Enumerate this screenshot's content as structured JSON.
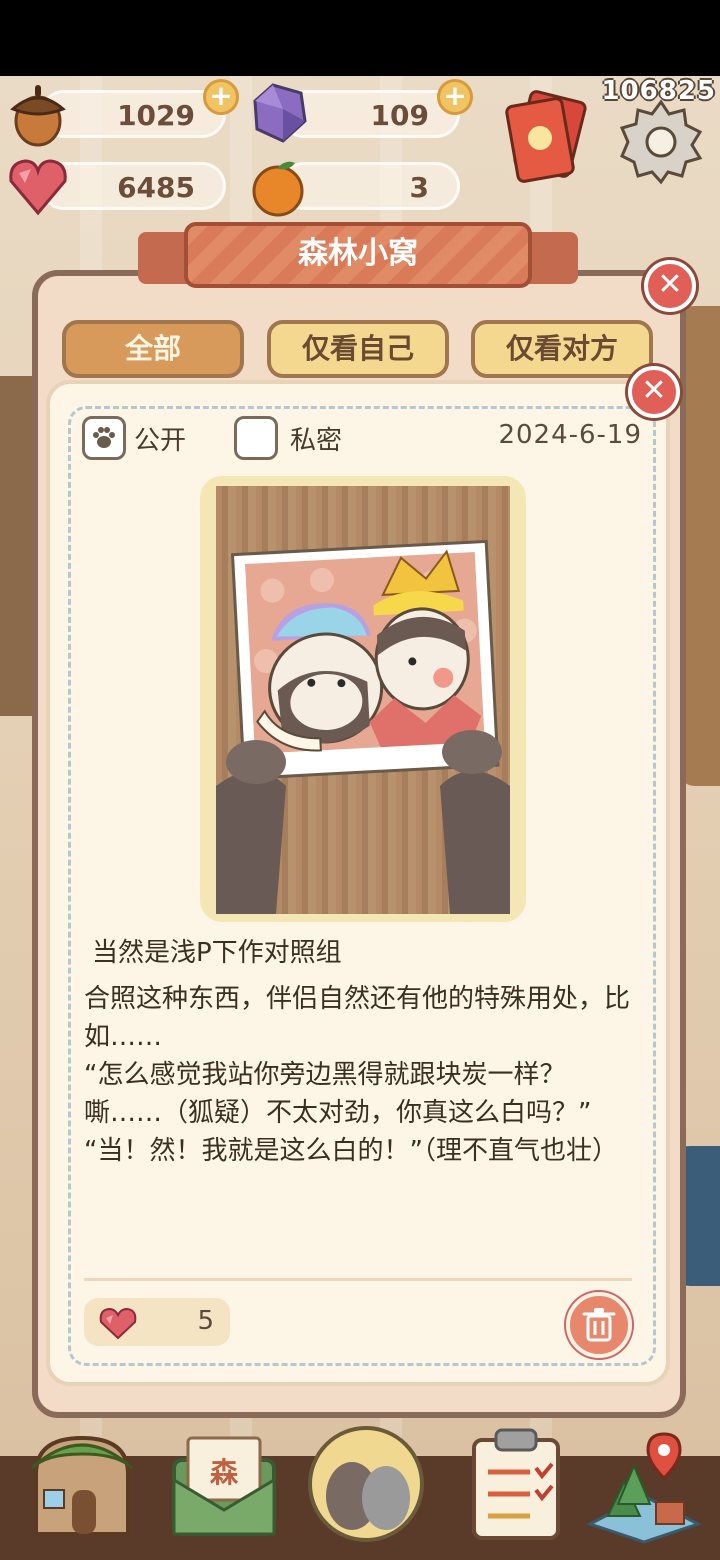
{
  "hud": {
    "id_label": "106825",
    "acorn": "1029",
    "gem": "109",
    "heart": "6485",
    "orange": "3"
  },
  "panel": {
    "title": "森林小窝",
    "tabs": [
      "全部",
      "仅看自己",
      "仅看对方"
    ],
    "active_tab": "全部"
  },
  "post": {
    "public_label": "公开",
    "private_label": "私密",
    "visibility": "公开",
    "date": "2024-6-19",
    "title": "当然是浅P下作对照组",
    "body": [
      "合照这种东西，伴侣自然还有他的特殊用处，比如……",
      "“怎么感觉我站你旁边黑得就跟块炭一样？嘶……（狐疑）不太对劲，你真这么白吗？”",
      "“当！然！我就是这么白的！”（理不直气也壮）"
    ],
    "likes": "5"
  },
  "icons": {
    "acorn": "acorn-icon",
    "gem": "purple-gem-icon",
    "heart": "heart-gem-icon",
    "orange": "orange-icon",
    "close": "close-icon",
    "trash": "trash-icon",
    "paw": "paw-icon"
  },
  "colors": {
    "accent_red": "#e06058",
    "tab_active": "#d89a5a",
    "tab_inactive": "#f5d890",
    "banner": "#e18a66"
  }
}
